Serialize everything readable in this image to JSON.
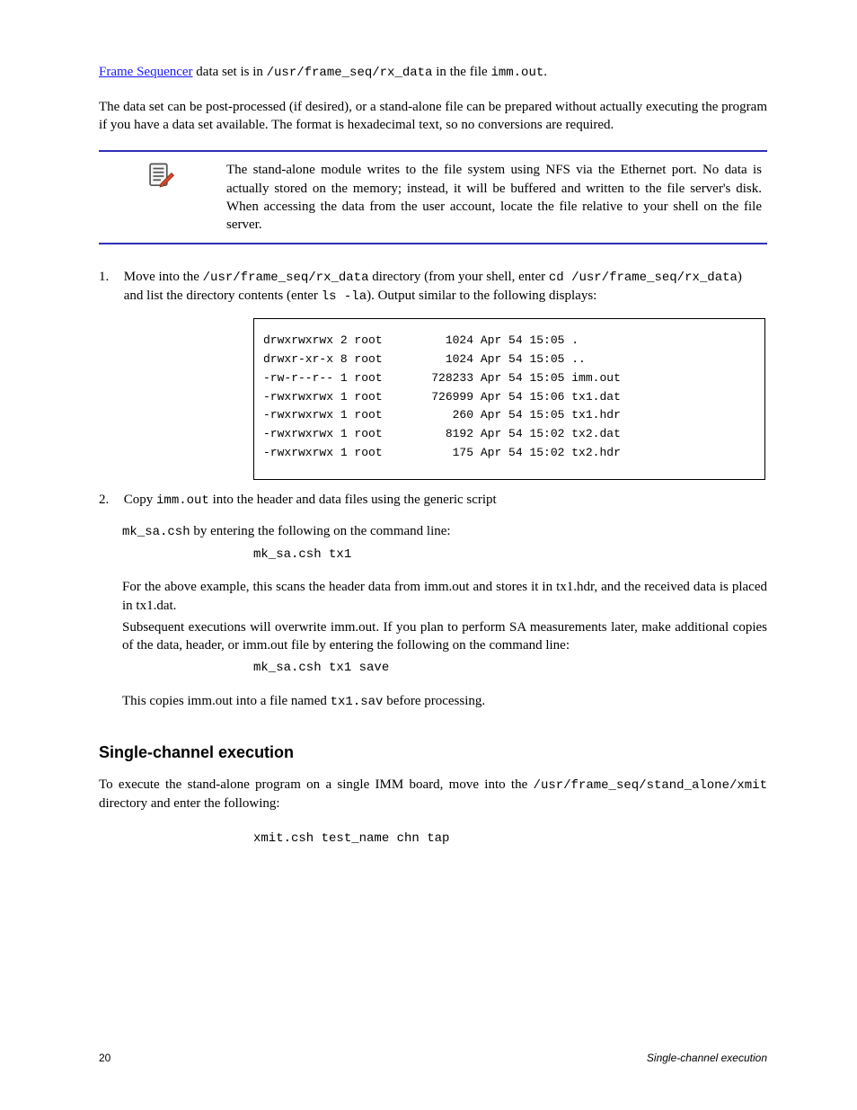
{
  "intro": {
    "link_text": "Frame Sequencer",
    "after_link": " data set is in ",
    "code1": "/usr/frame_seq/rx_data",
    "mid": " in the file ",
    "code2": "imm.out",
    "tail": "."
  },
  "para2": "The data set can be post-processed (if desired), or a stand-alone file can be prepared without actually executing the program if you have a data set available. The format is hexadecimal text, so no conversions are required.",
  "note_text": "The stand-alone module writes to the file system using NFS via the Ethernet port. No data is actually stored on the memory; instead, it will be buffered and written to the file server's disk. When accessing the data from the user account, locate the file relative to your shell on the file server.",
  "step1": {
    "num": "1.",
    "text_before": "Move into the ",
    "code_path": "/usr/frame_seq/rx_data",
    "text_mid": " directory (from your shell, enter ",
    "code_cmd": "cd /usr/frame_seq/rx_data",
    "text_after": ") and list the directory contents (enter ",
    "code_ls": "ls -la",
    "text_end": "). Output similar to the following displays:"
  },
  "code_box_lines": [
    "drwxrwxrwx 2 root         1024 Apr 54 15:05 .          ",
    "drwxr-xr-x 8 root         1024 Apr 54 15:05 ..         ",
    "-rw-r--r-- 1 root       728233 Apr 54 15:05 imm.out    ",
    "-rwxrwxrwx 1 root       726999 Apr 54 15:06 tx1.dat    ",
    "-rwxrwxrwx 1 root          260 Apr 54 15:05 tx1.hdr    ",
    "-rwxrwxrwx 1 root         8192 Apr 54 15:02 tx2.dat    ",
    "-rwxrwxrwx 1 root          175 Apr 54 15:02 tx2.hdr    "
  ],
  "step2": {
    "num": "2.",
    "line1_before": "Copy ",
    "line1_code": "imm.out",
    "line1_after": " into the header and data files using the generic script",
    "line2_before": "",
    "line2_code": "mk_sa.csh",
    "line2_after": " by entering the following on the command line:",
    "cmd1": "mk_sa.csh tx1",
    "line3": "For the above example, this scans the header data from imm.out and stores it in tx1.hdr, and the received data is placed in tx1.dat.",
    "line4": "Subsequent executions will overwrite imm.out. If you plan to perform SA measurements later, make additional copies of the data, header, or imm.out file by entering the following on the command line:",
    "cmd2": "mk_sa.csh tx1 save",
    "line5_before": "This copies imm.out into a file named ",
    "line5_code": "tx1.sav",
    "line5_after": " before processing."
  },
  "heading": "Single-channel execution",
  "bottom_para_before": "To execute the stand-alone program on a single IMM board, move into the ",
  "bottom_code": "/usr/frame_seq/stand_alone/xmit",
  "bottom_after": " directory and enter the following:",
  "bottom_cmd": "xmit.csh test_name chn tap",
  "footer_left": "20",
  "footer_right_italic": "Single-channel execution"
}
